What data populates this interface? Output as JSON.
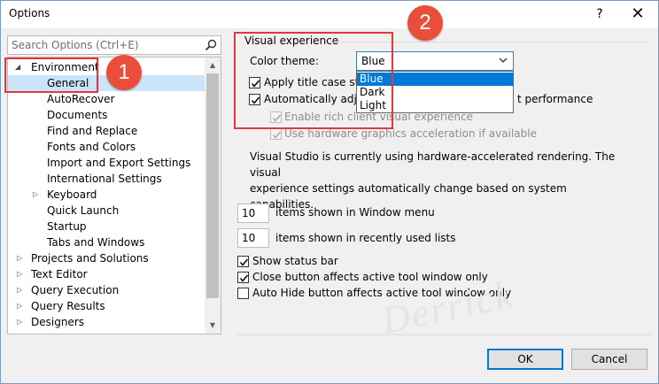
{
  "window": {
    "title": "Options",
    "help_glyph": "?",
    "close_glyph": "✕"
  },
  "search": {
    "placeholder": "Search Options (Ctrl+E)"
  },
  "tree": {
    "items": [
      {
        "label": "Environment",
        "expanded": true
      },
      {
        "label": "General",
        "selected": true
      },
      {
        "label": "AutoRecover"
      },
      {
        "label": "Documents"
      },
      {
        "label": "Find and Replace"
      },
      {
        "label": "Fonts and Colors"
      },
      {
        "label": "Import and Export Settings"
      },
      {
        "label": "International Settings"
      },
      {
        "label": "Keyboard"
      },
      {
        "label": "Quick Launch"
      },
      {
        "label": "Startup"
      },
      {
        "label": "Tabs and Windows"
      },
      {
        "label": "Projects and Solutions"
      },
      {
        "label": "Text Editor"
      },
      {
        "label": "Query Execution"
      },
      {
        "label": "Query Results"
      },
      {
        "label": "Designers"
      }
    ]
  },
  "visual": {
    "group_label": "Visual experience",
    "theme_label": "Color theme:",
    "theme_value": "Blue",
    "theme_options": [
      "Blue",
      "Dark",
      "Light"
    ],
    "apply_title_case": {
      "label": "Apply title case stylin",
      "checked": true
    },
    "auto_adjust": {
      "label": "Automatically adjust",
      "tail": "t performance",
      "checked": true
    },
    "rich_client": {
      "label": "Enable rich client visual experience",
      "checked": true,
      "disabled": true
    },
    "hw_accel": {
      "label": "Use hardware graphics acceleration if available",
      "checked": true,
      "disabled": true
    },
    "info_line1": "Visual Studio is currently using hardware-accelerated rendering. The visual",
    "info_line2": "experience settings automatically change based on system capabilities."
  },
  "window_menu": {
    "value": "10",
    "label": "items shown in Window menu"
  },
  "recent_lists": {
    "value": "10",
    "label": "items shown in recently used lists"
  },
  "options": {
    "status_bar": {
      "label": "Show status bar",
      "checked": true
    },
    "close_button": {
      "label": "Close button affects active tool window only",
      "checked": true
    },
    "auto_hide": {
      "label": "Auto Hide button affects active tool window only",
      "checked": false
    }
  },
  "buttons": {
    "ok": "OK",
    "cancel": "Cancel"
  },
  "annotations": {
    "badge1": "1",
    "badge2": "2",
    "callout_color": "#e8353b",
    "badge_color": "#e84e3a"
  },
  "watermark": "Derrick",
  "colors": {
    "selection": "#cce4f7",
    "accent": "#0078d7"
  }
}
